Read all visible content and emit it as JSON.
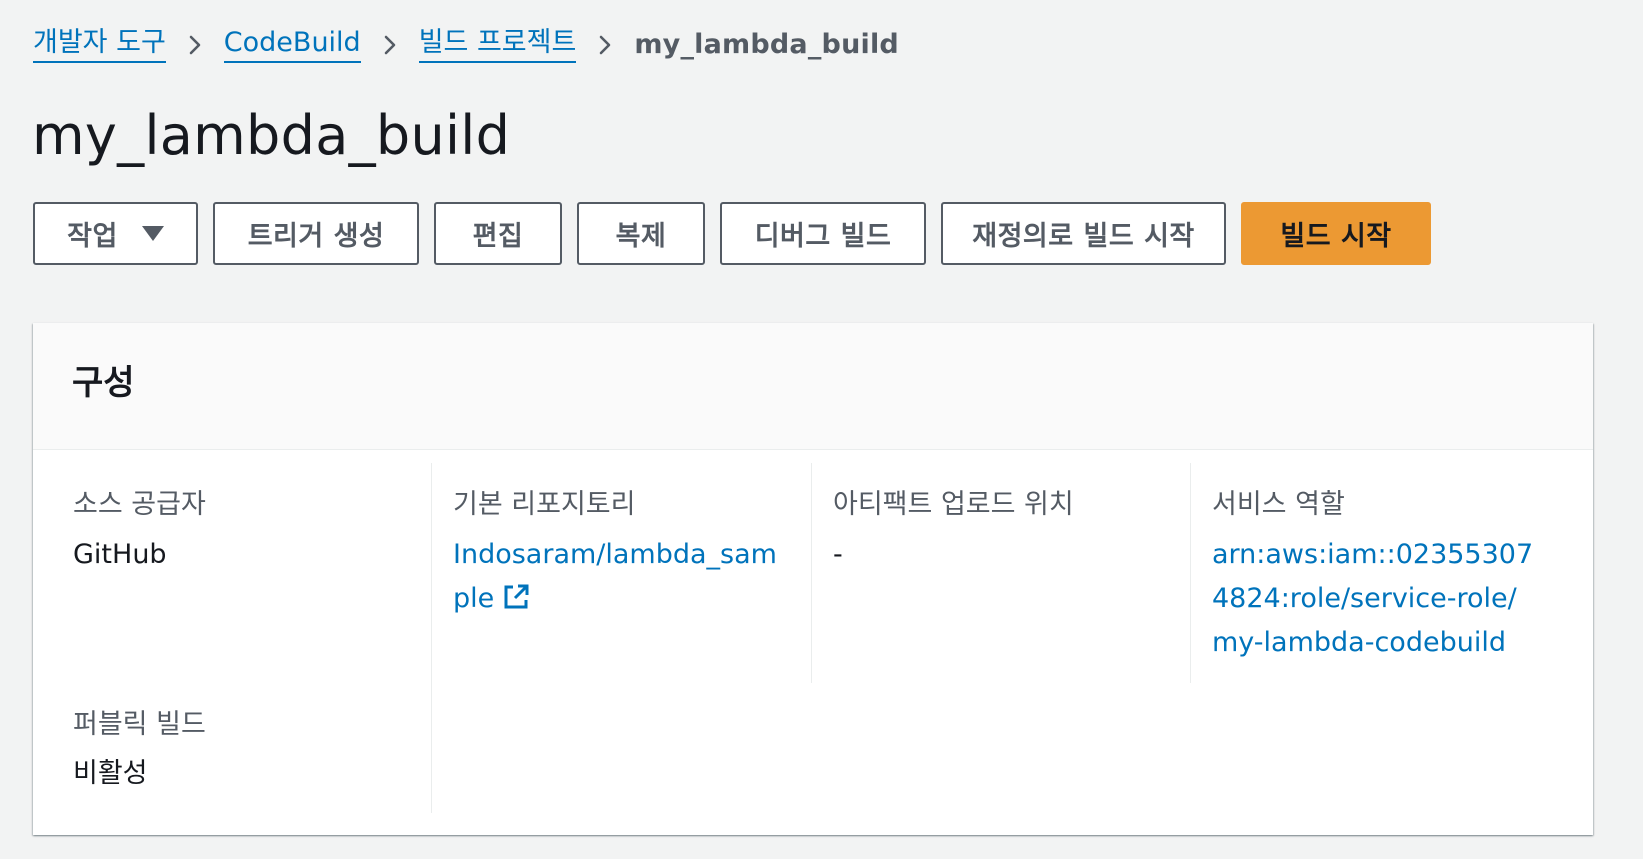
{
  "breadcrumb": {
    "items": [
      {
        "label": "개발자 도구"
      },
      {
        "label": "CodeBuild"
      },
      {
        "label": "빌드 프로젝트"
      }
    ],
    "current": "my_lambda_build"
  },
  "page_title": "my_lambda_build",
  "toolbar": {
    "actions_label": "작업",
    "create_trigger_label": "트리거 생성",
    "edit_label": "편집",
    "clone_label": "복제",
    "debug_build_label": "디버그 빌드",
    "start_build_with_overrides_label": "재정의로 빌드 시작",
    "start_build_label": "빌드 시작"
  },
  "configuration": {
    "title": "구성",
    "source_provider": {
      "label": "소스 공급자",
      "value": "GitHub"
    },
    "primary_repository": {
      "label": "기본 리포지토리",
      "value": "Indosaram/lambda_sample"
    },
    "artifacts_upload_location": {
      "label": "아티팩트 업로드 위치",
      "value": "-"
    },
    "service_role": {
      "label": "서비스 역할",
      "value": "arn:aws:iam::023553074824:role/service-role/my-lambda-codebuild"
    },
    "public_build": {
      "label": "퍼블릭 빌드",
      "value": "비활성"
    }
  },
  "colors": {
    "link": "#0073bb",
    "primary_button": "#ec9933",
    "background": "#f2f3f3"
  },
  "icons": {
    "breadcrumb_separator": "chevron-right-icon",
    "actions_dropdown": "caret-down-icon",
    "repository_link": "external-link-icon"
  }
}
